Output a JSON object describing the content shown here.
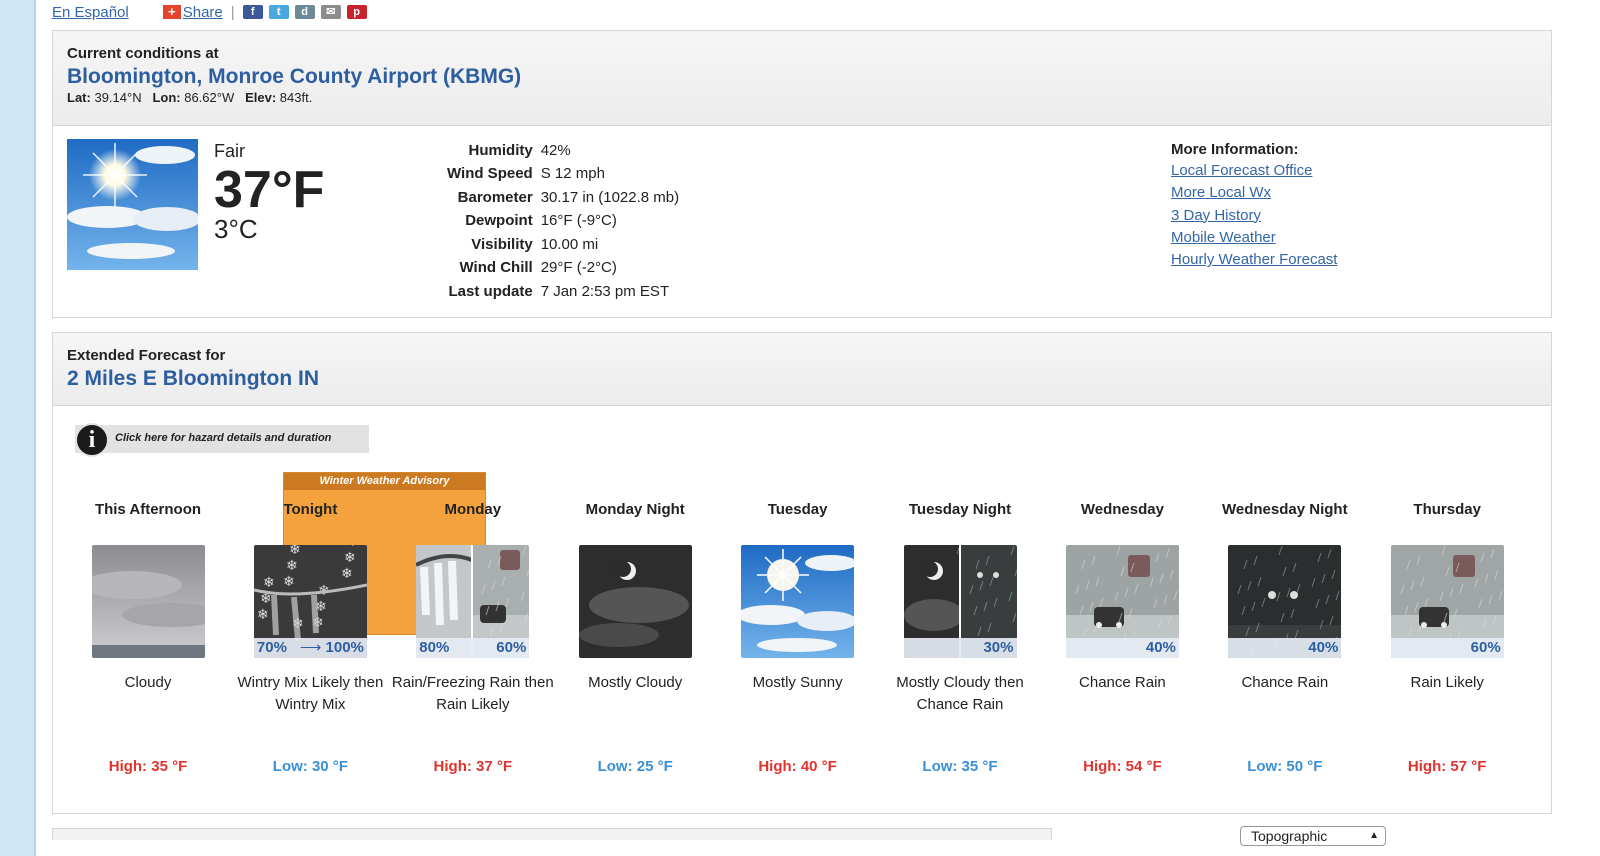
{
  "topbar": {
    "espanol": "En Español",
    "share": "Share"
  },
  "current": {
    "label": "Current conditions at",
    "location": "Bloomington, Monroe County Airport (KBMG)",
    "lat_label": "Lat:",
    "lat": "39.14°N",
    "lon_label": "Lon:",
    "lon": "86.62°W",
    "elev_label": "Elev:",
    "elev": "843ft.",
    "condition": "Fair",
    "temp_f": "37°F",
    "temp_c": "3°C",
    "details": [
      {
        "k": "Humidity",
        "v": "42%"
      },
      {
        "k": "Wind Speed",
        "v": "S 12 mph"
      },
      {
        "k": "Barometer",
        "v": "30.17 in (1022.8 mb)"
      },
      {
        "k": "Dewpoint",
        "v": "16°F (-9°C)"
      },
      {
        "k": "Visibility",
        "v": "10.00 mi"
      },
      {
        "k": "Wind Chill",
        "v": "29°F (-2°C)"
      },
      {
        "k": "Last update",
        "v": "7 Jan 2:53 pm EST"
      }
    ],
    "more_info": {
      "heading": "More Information:",
      "links": [
        "Local Forecast Office",
        "More Local Wx",
        "3 Day History",
        "Mobile Weather",
        "Hourly Weather Forecast"
      ]
    }
  },
  "extended": {
    "label": "Extended Forecast for",
    "location": "2 Miles E Bloomington IN",
    "hazard": "Click here for hazard details and duration",
    "advisory": "Winter Weather Advisory",
    "periods": [
      {
        "name": "This Afternoon",
        "desc": "Cloudy",
        "temp": "High: 35 °F",
        "kind": "hi",
        "pct_left": "",
        "pct_right": ""
      },
      {
        "name": "Tonight",
        "desc": "Wintry Mix Likely then Wintry Mix",
        "temp": "Low: 30 °F",
        "kind": "lo",
        "pct_left": "70%",
        "pct_right": "100%"
      },
      {
        "name": "Monday",
        "desc": "Rain/Freezing Rain then Rain Likely",
        "temp": "High: 37 °F",
        "kind": "hi",
        "pct_left": "80%",
        "pct_right": "60%"
      },
      {
        "name": "Monday Night",
        "desc": "Mostly Cloudy",
        "temp": "Low: 25 °F",
        "kind": "lo",
        "pct_left": "",
        "pct_right": ""
      },
      {
        "name": "Tuesday",
        "desc": "Mostly Sunny",
        "temp": "High: 40 °F",
        "kind": "hi",
        "pct_left": "",
        "pct_right": ""
      },
      {
        "name": "Tuesday Night",
        "desc": "Mostly Cloudy then Chance Rain",
        "temp": "Low: 35 °F",
        "kind": "lo",
        "pct_left": "",
        "pct_right": "30%"
      },
      {
        "name": "Wednesday",
        "desc": "Chance Rain",
        "temp": "High: 54 °F",
        "kind": "hi",
        "pct_left": "",
        "pct_right": "40%"
      },
      {
        "name": "Wednesday Night",
        "desc": "Chance Rain",
        "temp": "Low: 50 °F",
        "kind": "lo",
        "pct_left": "",
        "pct_right": "40%"
      },
      {
        "name": "Thursday",
        "desc": "Rain Likely",
        "temp": "High: 57 °F",
        "kind": "hi",
        "pct_left": "",
        "pct_right": "60%"
      }
    ]
  },
  "map_select": {
    "value": "Topographic"
  },
  "colors": {
    "link": "#3366a8",
    "high": "#e0342f",
    "low": "#3a8fd6",
    "advisory": "#f4a23d"
  }
}
